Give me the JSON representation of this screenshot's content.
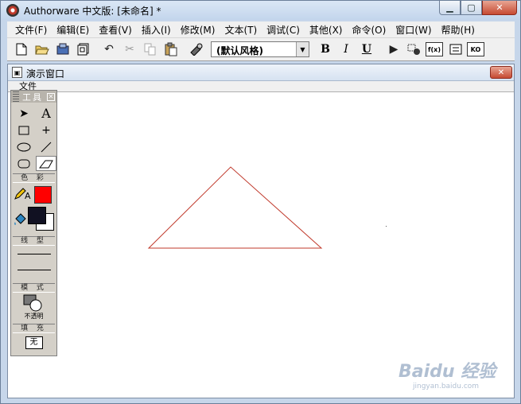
{
  "window": {
    "title": "Authorware 中文版: [未命名] *",
    "min_icon": "minimize-icon",
    "max_icon": "maximize-icon",
    "close_icon": "close-icon"
  },
  "menubar": {
    "items": [
      "文件(F)",
      "编辑(E)",
      "查看(V)",
      "插入(I)",
      "修改(M)",
      "文本(T)",
      "调试(C)",
      "其他(X)",
      "命令(O)",
      "窗口(W)",
      "帮助(H)"
    ]
  },
  "toolbar": {
    "style_value": "(默认风格)",
    "bold_label": "B",
    "italic_label": "I",
    "underline_label": "U",
    "fx_label": "f(x)",
    "ko_label": "KO"
  },
  "presentation": {
    "title": "演示窗口",
    "menu_item": "文件"
  },
  "tools": {
    "title": "工具",
    "color_label": "色 彩",
    "line_label": "线 型",
    "mode_label": "模 式",
    "mode_value": "不透明",
    "fill_label": "填 充",
    "fill_value": "无",
    "pen_color": "#ff0000",
    "fill_fg_color": "#111122",
    "fill_bg_color": "#ffffff"
  },
  "canvas": {
    "triangle_color": "#c0392b"
  },
  "watermark": {
    "logo": "Baidu 经验",
    "url": "jingyan.baidu.com"
  }
}
